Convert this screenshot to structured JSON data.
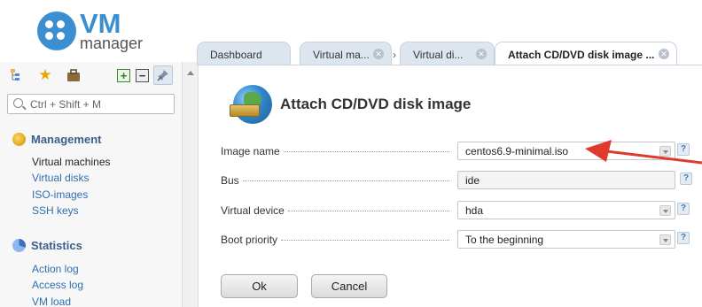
{
  "logo": {
    "title": "VM",
    "subtitle": "manager"
  },
  "sidebar": {
    "toolbar": {
      "tree_icon": "tree-icon",
      "favorites_icon": "star-icon",
      "briefcase_icon": "briefcase-icon",
      "expand_icon": "plus-box-icon",
      "collapse_icon": "minus-box-icon",
      "pin_icon": "pin-icon"
    },
    "search": {
      "placeholder": "Ctrl + Shift + M"
    },
    "sections": [
      {
        "title": "Management",
        "items": [
          "Virtual machines",
          "Virtual disks",
          "ISO-images",
          "SSH keys"
        ]
      },
      {
        "title": "Statistics",
        "items": [
          "Action log",
          "Access log",
          "VM load"
        ]
      }
    ]
  },
  "tabs": [
    {
      "label": "Dashboard"
    },
    {
      "label": "Virtual ma..."
    },
    {
      "label": "Virtual di..."
    },
    {
      "label": "Attach CD/DVD disk image ..."
    }
  ],
  "form": {
    "title": "Attach CD/DVD disk image",
    "fields": [
      {
        "label": "Image name",
        "value": "centos6.9-minimal.iso"
      },
      {
        "label": "Bus",
        "value": "ide"
      },
      {
        "label": "Virtual device",
        "value": "hda"
      },
      {
        "label": "Boot priority",
        "value": "To the beginning"
      }
    ],
    "help": "?",
    "ok_label": "Ok",
    "cancel_label": "Cancel"
  },
  "colors": {
    "brand": "#3b8ed0",
    "link": "#2f6fb0",
    "section": "#3a5f8a",
    "annotation_arrow": "#e03a2f"
  }
}
